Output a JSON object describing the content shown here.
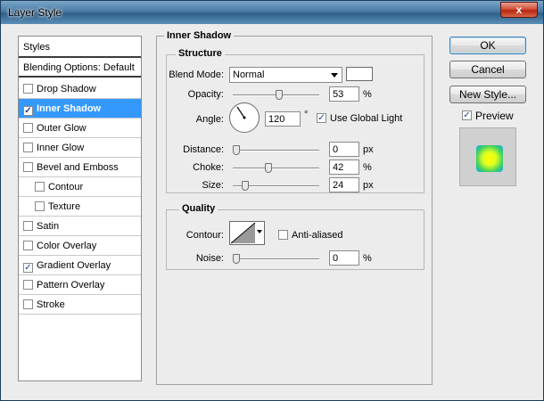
{
  "window": {
    "title": "Layer Style",
    "close_label": "x"
  },
  "sidebar": {
    "items": [
      {
        "label": "Styles",
        "checkbox": false,
        "checked": false
      },
      {
        "label": "Blending Options: Default",
        "checkbox": false,
        "checked": false
      },
      {
        "label": "Drop Shadow",
        "checkbox": true,
        "checked": false
      },
      {
        "label": "Inner Shadow",
        "checkbox": true,
        "checked": true,
        "selected": true
      },
      {
        "label": "Outer Glow",
        "checkbox": true,
        "checked": false
      },
      {
        "label": "Inner Glow",
        "checkbox": true,
        "checked": false
      },
      {
        "label": "Bevel and Emboss",
        "checkbox": true,
        "checked": false
      },
      {
        "label": "Contour",
        "checkbox": true,
        "checked": false,
        "sub": true
      },
      {
        "label": "Texture",
        "checkbox": true,
        "checked": false,
        "sub": true
      },
      {
        "label": "Satin",
        "checkbox": true,
        "checked": false
      },
      {
        "label": "Color Overlay",
        "checkbox": true,
        "checked": false
      },
      {
        "label": "Gradient Overlay",
        "checkbox": true,
        "checked": true
      },
      {
        "label": "Pattern Overlay",
        "checkbox": true,
        "checked": false
      },
      {
        "label": "Stroke",
        "checkbox": true,
        "checked": false
      }
    ]
  },
  "panel": {
    "title": "Inner Shadow",
    "structure": {
      "title": "Structure",
      "blend_mode_label": "Blend Mode:",
      "blend_mode_value": "Normal",
      "shadow_color": "#ffffff",
      "opacity_label": "Opacity:",
      "opacity_value": "53",
      "opacity_unit": "%",
      "angle_label": "Angle:",
      "angle_value": "120",
      "angle_unit": "°",
      "global_light_label": "Use Global Light",
      "global_light_checked": true,
      "distance_label": "Distance:",
      "distance_value": "0",
      "distance_unit": "px",
      "choke_label": "Choke:",
      "choke_value": "42",
      "choke_unit": "%",
      "size_label": "Size:",
      "size_value": "24",
      "size_unit": "px"
    },
    "quality": {
      "title": "Quality",
      "contour_label": "Contour:",
      "anti_aliased_label": "Anti-aliased",
      "anti_aliased_checked": false,
      "noise_label": "Noise:",
      "noise_value": "0",
      "noise_unit": "%"
    }
  },
  "buttons": {
    "ok": "OK",
    "cancel": "Cancel",
    "new_style": "New Style..."
  },
  "preview": {
    "label": "Preview",
    "checked": true
  }
}
